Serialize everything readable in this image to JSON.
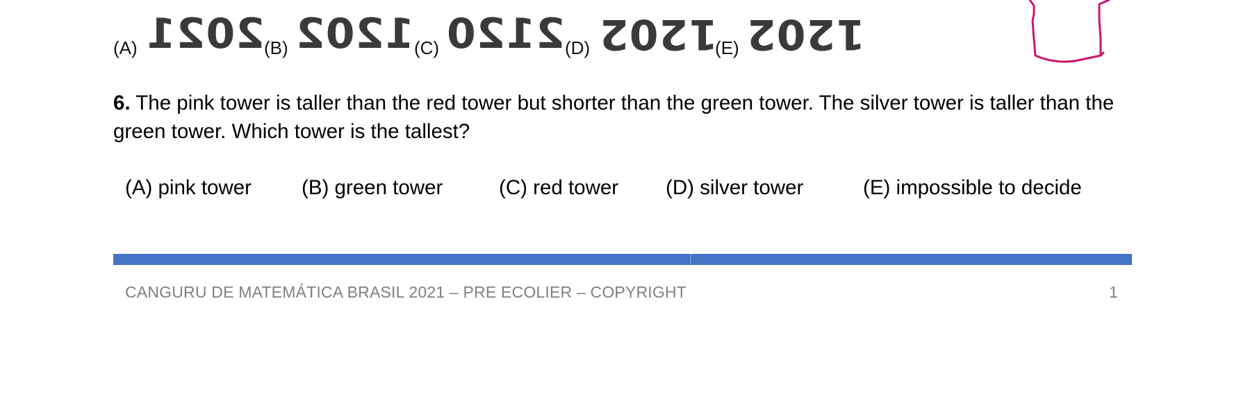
{
  "prev_question": {
    "options": [
      {
        "label": "(A)",
        "value": "2021"
      },
      {
        "label": "(B)",
        "value": "1202"
      },
      {
        "label": "(C)",
        "value": "2120"
      },
      {
        "label": "(D)",
        "value": "1202"
      },
      {
        "label": "(E)",
        "value": "1202"
      }
    ]
  },
  "question6": {
    "number": "6.",
    "text": "The pink tower is taller than the red tower but shorter than the green tower. The silver tower is taller than the green tower. Which tower is the tallest?",
    "answers": [
      "(A) pink tower",
      "(B) green tower",
      "(C) red tower",
      "(D) silver tower",
      "(E) impossible to decide"
    ]
  },
  "footer": {
    "left": "CANGURU DE MATEMÁTICA BRASIL 2021 – PRE ECOLIER – COPYRIGHT",
    "page": "1"
  },
  "colors": {
    "bar": "#4472c4",
    "shirt": "#c8146e",
    "footer_text": "#808080"
  },
  "icons": {
    "shirt": "t-shirt-outline-icon"
  }
}
